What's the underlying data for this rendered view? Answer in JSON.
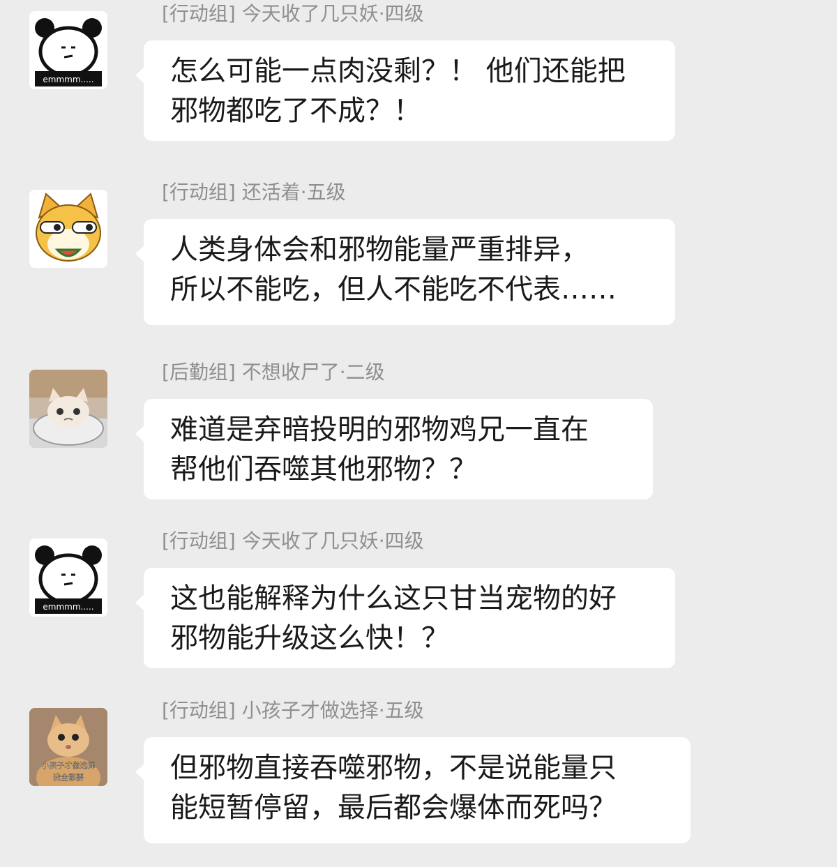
{
  "messages": [
    {
      "avatar": "panda-emmmm-icon",
      "avatar_caption": "emmmm.....",
      "sender": "[行动组] 今天收了几只妖·四级",
      "lines": [
        "怎么可能一点肉没剩？！ 他们还能把",
        "邪物都吃了不成？！"
      ]
    },
    {
      "avatar": "shiba-dog-icon",
      "sender": "[行动组] 还活着·五级",
      "lines": [
        "人类身体会和邪物能量严重排异，",
        "所以不能吃，但人不能吃不代表……"
      ]
    },
    {
      "avatar": "crying-cat-icon",
      "sender": "[后勤组] 不想收尸了·二级",
      "lines": [
        "难道是弃暗投明的邪物鸡兄一直在",
        "帮他们吞噬其他邪物？？"
      ]
    },
    {
      "avatar": "panda-emmmm-icon",
      "avatar_caption": "emmmm.....",
      "sender": "[行动组] 今天收了几只妖·四级",
      "lines": [
        "这也能解释为什么这只甘当宠物的好",
        "邪物能升级这么快！？"
      ]
    },
    {
      "avatar": "cat-meme-icon",
      "avatar_caption": "小孩子才做选择\n我全都要",
      "sender": "[行动组] 小孩子才做选择·五级",
      "lines": [
        "但邪物直接吞噬邪物，不是说能量只",
        "能短暂停留，最后都会爆体而死吗？"
      ]
    }
  ]
}
